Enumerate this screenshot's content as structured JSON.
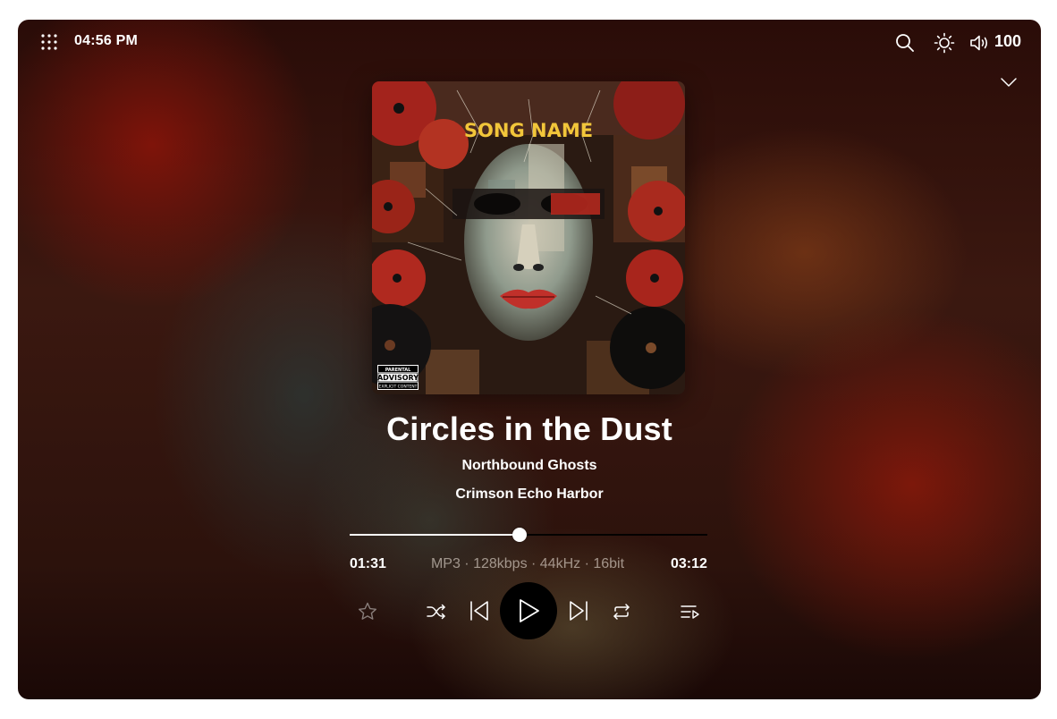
{
  "status_bar": {
    "time": "04:56 PM",
    "volume": "100",
    "icons": [
      "apps-grid-icon",
      "search-icon",
      "brightness-icon",
      "volume-icon"
    ]
  },
  "cover": {
    "text": "SONG NAME",
    "advisory_lines": [
      "PARENTAL",
      "ADVISORY",
      "EXPLICIT CONTENT"
    ]
  },
  "track": {
    "title": "Circles in the Dust",
    "artist": "Northbound Ghosts",
    "album": "Crimson Echo Harbor"
  },
  "playback": {
    "current_time": "01:31",
    "total_time": "03:12",
    "format": "MP3 · 128kbps · 44kHz · 16bit",
    "progress": 0.474
  },
  "controls": [
    "star-icon",
    "shuffle-icon",
    "previous-icon",
    "play-icon",
    "next-icon",
    "repeat-icon",
    "queue-icon"
  ],
  "colors": {
    "background": "#2a0c08",
    "text": "#ffffff",
    "play_button": "#000000"
  }
}
